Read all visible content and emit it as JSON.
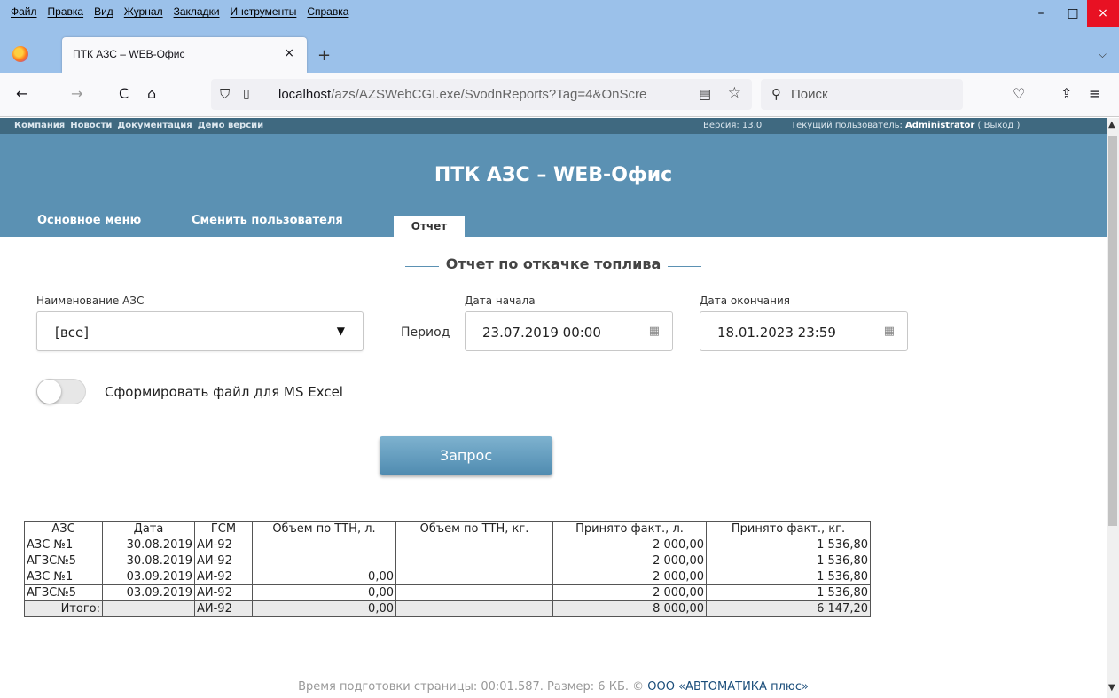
{
  "browser": {
    "menu": [
      "Файл",
      "Правка",
      "Вид",
      "Журнал",
      "Закладки",
      "Инструменты",
      "Справка"
    ],
    "window_controls": {
      "minimize": "–",
      "maximize": "□",
      "close": "×"
    },
    "tab": {
      "title": "ПТК АЗС – WEB-Офис",
      "close": "×"
    },
    "new_tab": "+",
    "tab_list": "⌵",
    "nav": {
      "back": "←",
      "forward": "→",
      "reload": "C",
      "home": "⌂",
      "pocket": "♡",
      "extensions": "⇪",
      "menu": "≡"
    },
    "url_host": "localhost",
    "url_path": "/azs/AZSWebCGI.exe/SvodnReports?Tag=4&OnScre",
    "search_placeholder": "Поиск"
  },
  "site": {
    "top_links": [
      "Компания",
      "Новости",
      "Документация",
      "Демо версии"
    ],
    "version": "Версия: 13.0",
    "user_prefix": "Текущий пользователь: ",
    "user_name": "Administrator",
    "logout": " ( Выход )",
    "app_title": "ПТК АЗС – WEB-Офис",
    "nav": {
      "main": "Основное меню",
      "switch_user": "Сменить пользователя",
      "report": "Отчет"
    }
  },
  "form": {
    "report_title": "Отчет по откачке топлива",
    "station_label": "Наименование АЗС",
    "station_value": "[все]",
    "period_label": "Период",
    "start_label": "Дата начала",
    "start_value": "23.07.2019 00:00",
    "end_label": "Дата окончания",
    "end_value": "18.01.2023 23:59",
    "excel_label": "Сформировать файл для MS Excel",
    "excel_enabled": false,
    "submit_label": "Запрос"
  },
  "table": {
    "columns": [
      "АЗС",
      "Дата",
      "ГСМ",
      "Объем по ТТН, л.",
      "Объем по ТТН, кг.",
      "Принято факт., л.",
      "Принято факт., кг."
    ],
    "rows": [
      [
        "АЗС №1",
        "30.08.2019",
        "АИ-92",
        "",
        "",
        "2 000,00",
        "1 536,80"
      ],
      [
        "АГЗС№5",
        "30.08.2019",
        "АИ-92",
        "",
        "",
        "2 000,00",
        "1 536,80"
      ],
      [
        "АЗС №1",
        "03.09.2019",
        "АИ-92",
        "0,00",
        "",
        "2 000,00",
        "1 536,80"
      ],
      [
        "АГЗС№5",
        "03.09.2019",
        "АИ-92",
        "0,00",
        "",
        "2 000,00",
        "1 536,80"
      ]
    ],
    "total": [
      "Итого:",
      "",
      "АИ-92",
      "0,00",
      "",
      "8 000,00",
      "6 147,20"
    ]
  },
  "footer": {
    "text": "Время подготовки страницы: 00:01.587. Размер: 6 КБ. © ",
    "company": "ООО «АВТОМАТИКА плюс»"
  },
  "colors": {
    "header_bg": "#5b91b3",
    "top_strip": "#3f6980",
    "browser_chrome": "#9bc1ea",
    "close_btn": "#e81123"
  }
}
